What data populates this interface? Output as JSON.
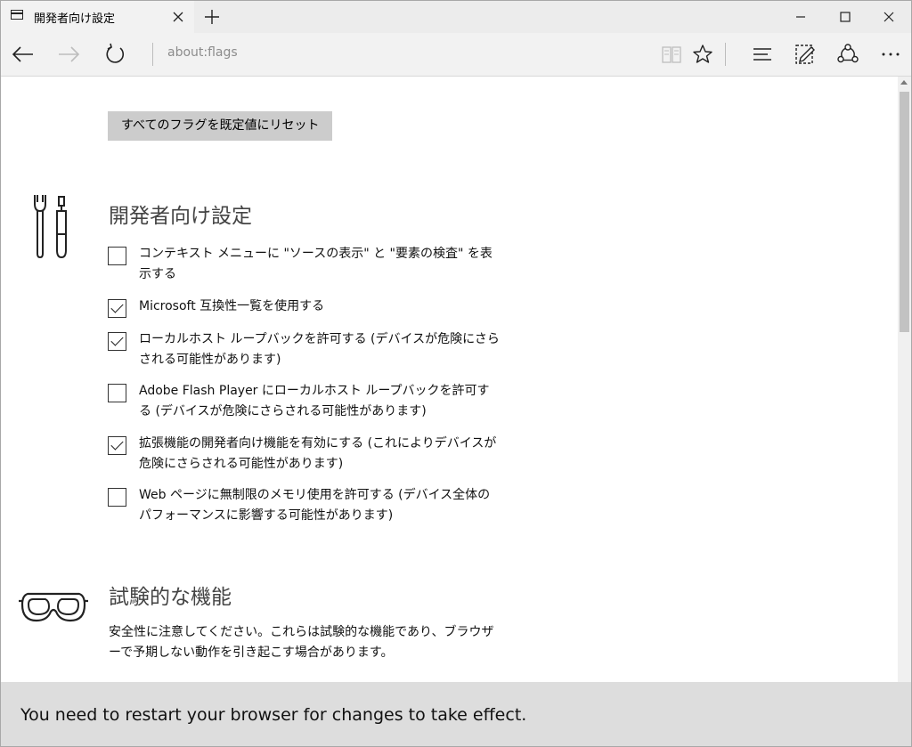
{
  "tab": {
    "title": "開発者向け設定"
  },
  "address": {
    "url": "about:flags"
  },
  "reset_button": {
    "label": "すべてのフラグを既定値にリセット"
  },
  "developer": {
    "title": "開発者向け設定",
    "options": [
      {
        "label": "コンテキスト メニューに \"ソースの表示\" と \"要素の検査\" を表示する",
        "checked": false
      },
      {
        "label": "Microsoft 互換性一覧を使用する",
        "checked": true
      },
      {
        "label": "ローカルホスト ループバックを許可する (デバイスが危険にさらされる可能性があります)",
        "checked": true
      },
      {
        "label": "Adobe Flash Player にローカルホスト ループバックを許可する (デバイスが危険にさらされる可能性があります)",
        "checked": false
      },
      {
        "label": "拡張機能の開発者向け機能を有効にする (これによりデバイスが危険にさらされる可能性があります)",
        "checked": true
      },
      {
        "label": "Web ページに無制限のメモリ使用を許可する (デバイス全体のパフォーマンスに影響する可能性があります)",
        "checked": false
      }
    ]
  },
  "experimental": {
    "title": "試験的な機能",
    "description": "安全性に注意してください。これらは試験的な機能であり、ブラウザーで予期しない動作を引き起こす場合があります。"
  },
  "banner": {
    "text": "You need to restart your browser for changes to take effect."
  },
  "icons": {
    "tab": "page-icon",
    "tab_close": "close-icon",
    "new_tab": "plus-icon",
    "minimize": "minimize-icon",
    "maximize": "maximize-icon",
    "close": "close-icon",
    "back": "arrow-left-icon",
    "forward": "arrow-right-icon",
    "refresh": "refresh-icon",
    "reading_view": "book-icon",
    "favorites": "star-icon",
    "hub": "hub-icon",
    "web_note": "pen-icon",
    "share": "share-icon",
    "more": "more-icon",
    "developer": "tools-icon",
    "experimental": "goggles-icon"
  },
  "colors": {
    "banner_bg": "#dddddd",
    "button_bg": "#cccccc",
    "chrome_bg": "#f2f2f2"
  }
}
